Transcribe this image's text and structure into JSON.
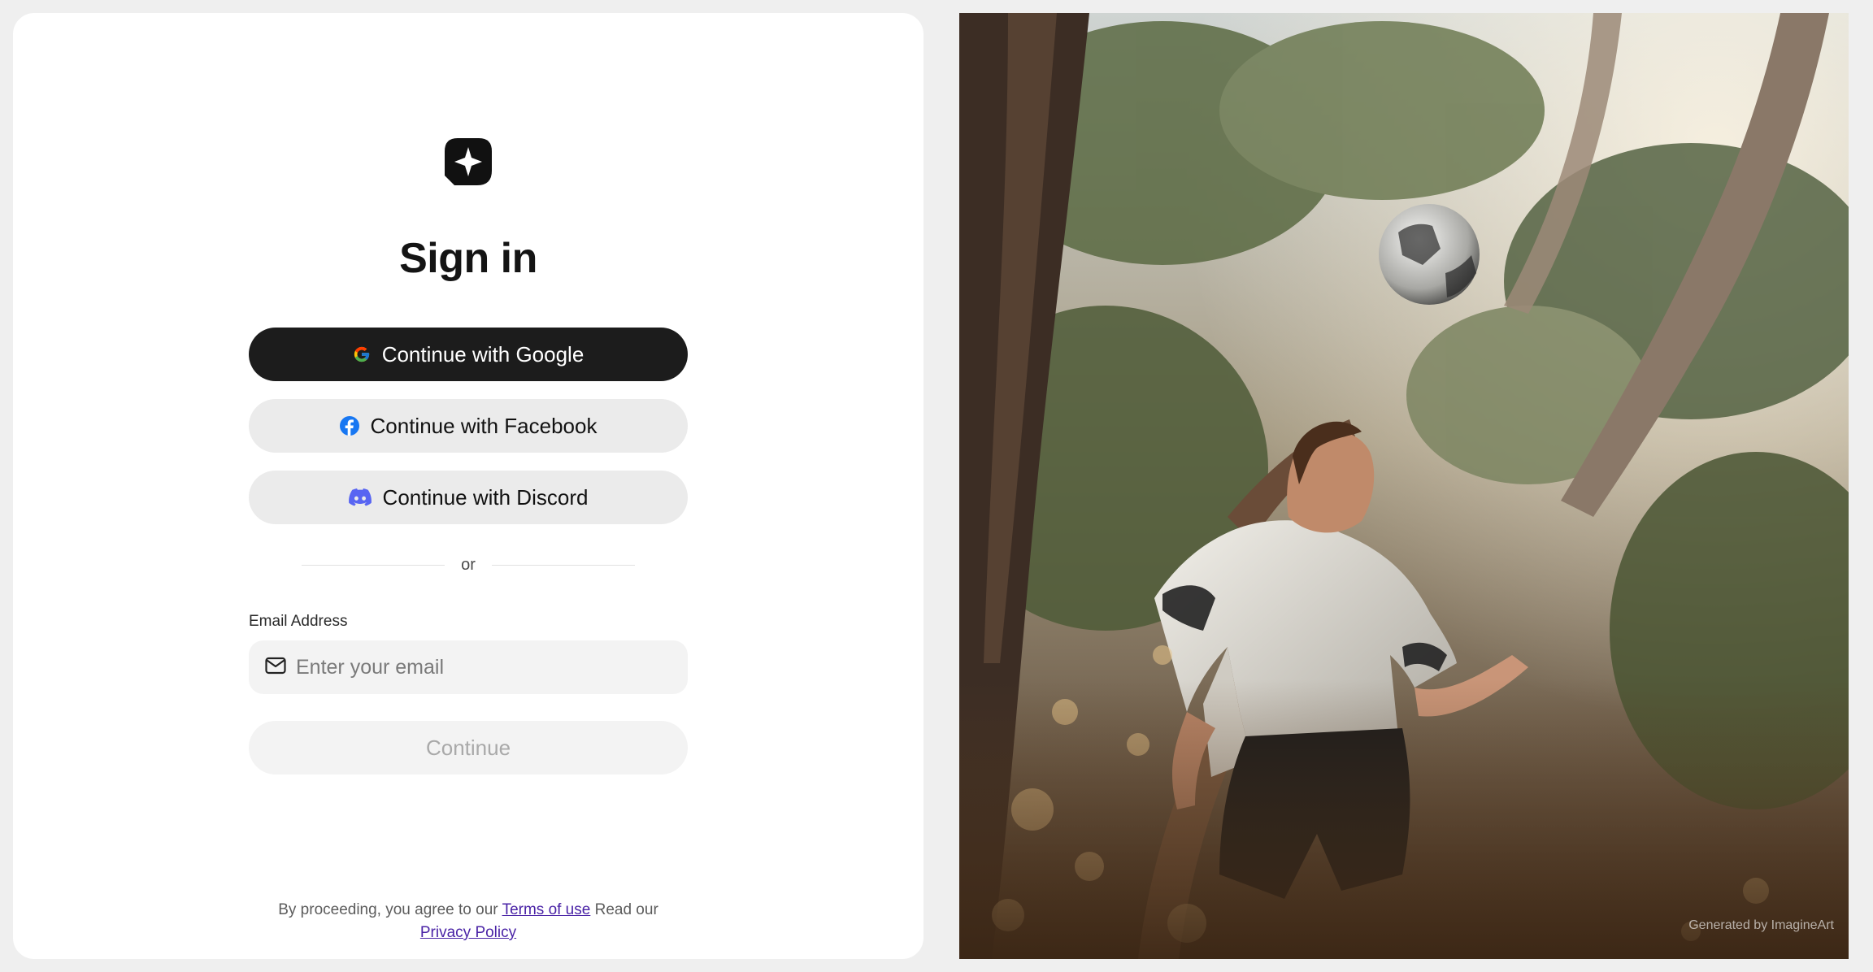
{
  "auth": {
    "title": "Sign in",
    "google_label": "Continue with Google",
    "facebook_label": "Continue with Facebook",
    "discord_label": "Continue with Discord",
    "divider_text": "or",
    "email_label": "Email Address",
    "email_placeholder": "Enter your email",
    "email_value": "",
    "continue_label": "Continue"
  },
  "footer": {
    "prefix": "By proceeding, you agree to our",
    "terms_link": "Terms of use",
    "middle": "Read our",
    "privacy_link": "Privacy Policy"
  },
  "hero": {
    "credit": "Generated by ImagineArt"
  },
  "colors": {
    "primary_button": "#1c1c1c",
    "secondary_button": "#ebebeb",
    "link": "#4a23a6",
    "facebook": "#1877f2",
    "discord": "#5865f2"
  },
  "icons": [
    "logo-icon",
    "google-icon",
    "facebook-icon",
    "discord-icon",
    "mail-icon"
  ]
}
